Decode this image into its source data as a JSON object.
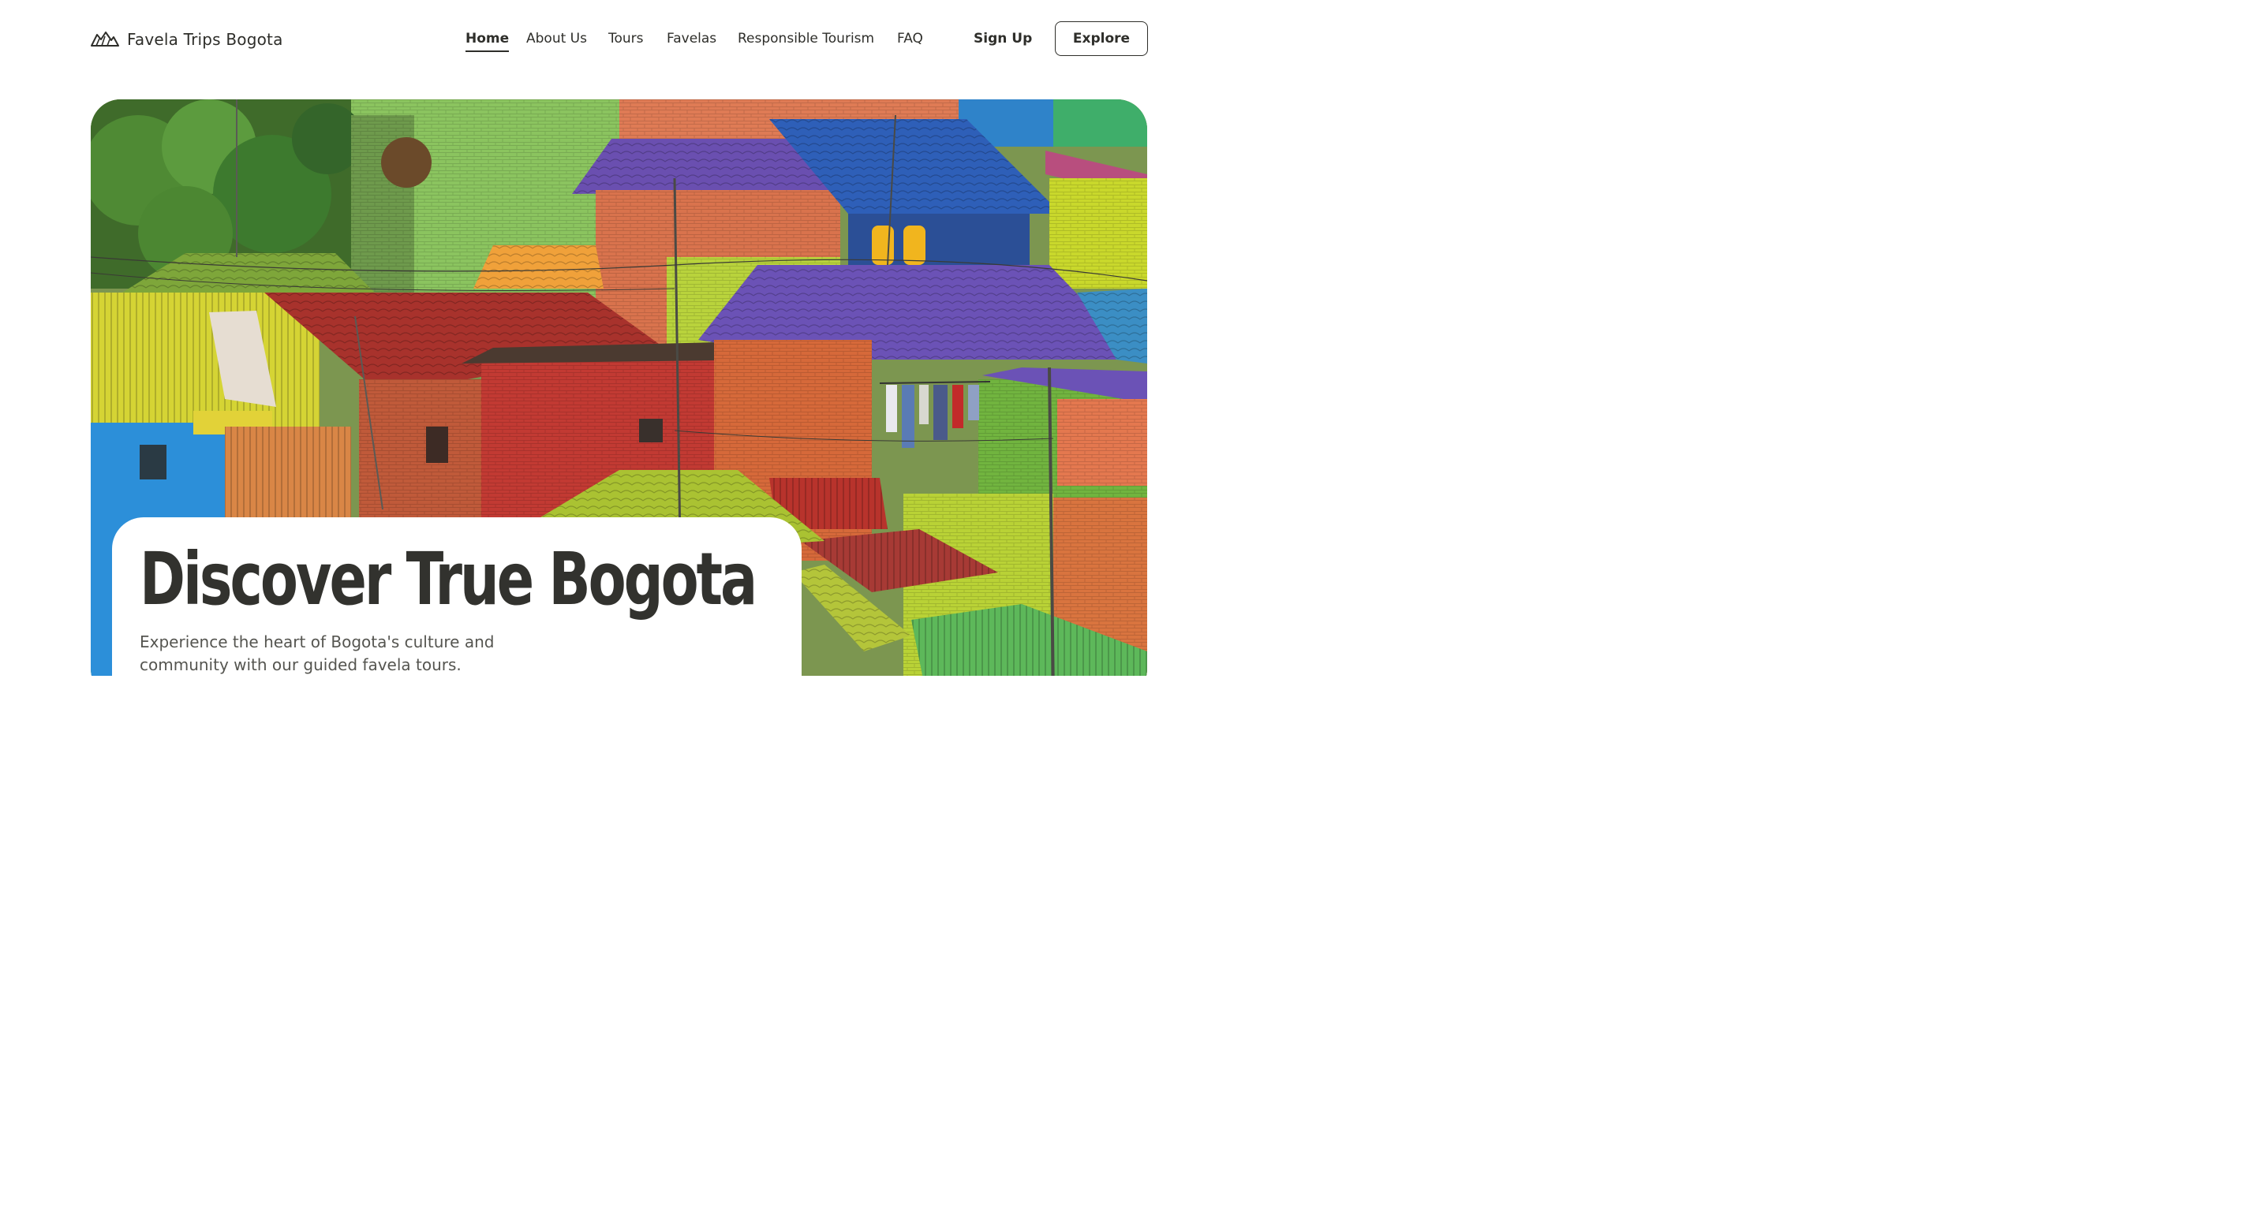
{
  "brand": {
    "name": "Favela Trips Bogota",
    "logo_icon": "hills-logo-icon"
  },
  "nav": {
    "items": [
      {
        "label": "Home",
        "active": true
      },
      {
        "label": "About Us",
        "active": false
      },
      {
        "label": "Tours",
        "active": false
      },
      {
        "label": "Favelas",
        "active": false
      },
      {
        "label": "Responsible Tourism",
        "active": false
      },
      {
        "label": "FAQ",
        "active": false
      }
    ]
  },
  "auth": {
    "signup_label": "Sign Up",
    "explore_label": "Explore"
  },
  "hero": {
    "image_subject": "colorful hillside houses",
    "title": "Discover True Bogota",
    "subtitle": "Experience the heart of Bogota's culture and community with our guided favela tours."
  },
  "colors": {
    "text": "#2e2e2a",
    "background": "#ffffff",
    "roof_purple": "#6a4fb0",
    "roof_blue": "#2e5fb8",
    "roof_red": "#a8322c",
    "wall_green": "#86c25a",
    "wall_yellow": "#d9d832",
    "wall_orange": "#e0754a"
  }
}
